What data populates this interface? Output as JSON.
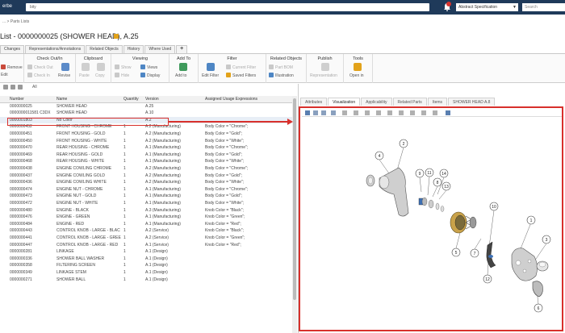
{
  "app": {
    "brand_fragment": "erbe"
  },
  "topbar": {
    "url": "bity",
    "context": "Abstract Specification",
    "search_placeholder": "Search",
    "colors": {
      "bar": "#1f3a5a",
      "alert": "#d8322c"
    }
  },
  "breadcrumb": "... > Parts Lists",
  "page_title": "List - 0000000025 (SHOWER HEAD), A.25",
  "tabs": [
    "Changes",
    "Representations/Annotations",
    "Related Objects",
    "History",
    "Where Used",
    "+"
  ],
  "ribbon": {
    "edit": {
      "remove": "Remove",
      "edit": "Edit"
    },
    "checkout": {
      "title": "Check Out/In",
      "check_out": "Check Out",
      "check_in": "Check In",
      "revise": "Revise"
    },
    "clipboard": {
      "title": "Clipboard",
      "paste": "Paste",
      "copy": "Copy"
    },
    "viewing": {
      "title": "Viewing",
      "show": "Show",
      "hide": "Hide",
      "views": "Views",
      "display": "Display"
    },
    "add_to": {
      "title": "Add To",
      "add_to": "Add to"
    },
    "filter": {
      "title": "Filter",
      "edit_filter": "Edit Filter",
      "current_filter": "Current Filter",
      "saved_filters": "Saved Filters"
    },
    "related": {
      "title": "Related Objects",
      "part_bom": "Part BOM",
      "illustration": "Illustration"
    },
    "publish": {
      "title": "Publish",
      "representation": "Representation"
    },
    "tools": {
      "title": "Tools",
      "open_in": "Open in"
    }
  },
  "filter_row": {
    "label": "All"
  },
  "table": {
    "columns": [
      "Number",
      "Name",
      "Quantity",
      "Version",
      "Assigned Usage Expressions"
    ],
    "rows": [
      [
        "0000000025",
        "SHOWER HEAD",
        "",
        "A.25",
        ""
      ],
      [
        "0000000011581 C3DX",
        "SHOWER HEAD",
        "",
        "A.10",
        ""
      ],
      [
        "0000001803",
        "No Color",
        "",
        "A.2",
        ""
      ],
      [
        "0000000452",
        "FRONT HOUSING - CHROME",
        "1",
        "A.2 (Manufacturing)",
        "Body Color = \"Chrome\";"
      ],
      [
        "0000000451",
        "FRONT HOUSING - GOLD",
        "1",
        "A.2 (Manufacturing)",
        "Body Color = \"Gold\";"
      ],
      [
        "0000000450",
        "FRONT HOUSING - WHITE",
        "1",
        "A.2 (Manufacturing)",
        "Body Color = \"White\";"
      ],
      [
        "0000000470",
        "REAR HOUSING - CHROME",
        "1",
        "A.1 (Manufacturing)",
        "Body Color = \"Chrome\";"
      ],
      [
        "0000000469",
        "REAR HOUSING - GOLD",
        "1",
        "A.1 (Manufacturing)",
        "Body Color = \"Gold\";"
      ],
      [
        "0000000468",
        "REAR HOUSING - WHITE",
        "1",
        "A.1 (Manufacturing)",
        "Body Color = \"White\";"
      ],
      [
        "0000000438",
        "ENGINE COWLING CHROME",
        "1",
        "A.2 (Manufacturing)",
        "Body Color = \"Chrome\";"
      ],
      [
        "0000000437",
        "ENGINE COWLING GOLD",
        "1",
        "A.2 (Manufacturing)",
        "Body Color = \"Gold\";"
      ],
      [
        "0000000436",
        "ENGINE COWLING WHITE",
        "1",
        "A.2 (Manufacturing)",
        "Body Color = \"White\";"
      ],
      [
        "0000000474",
        "ENGINE NUT - CHROME",
        "1",
        "A.1 (Manufacturing)",
        "Body Color = \"Chrome\";"
      ],
      [
        "0000000473",
        "ENGINE NUT - GOLD",
        "1",
        "A.1 (Manufacturing)",
        "Body Color = \"Gold\";"
      ],
      [
        "0000000472",
        "ENGINE NUT - WHITE",
        "1",
        "A.1 (Manufacturing)",
        "Body Color = \"White\";"
      ],
      [
        "0000000480",
        "ENGINE - BLACK",
        "1",
        "A.3 (Manufacturing)",
        "Knob Color = \"Black\";"
      ],
      [
        "0000000476",
        "ENGINE - GREEN",
        "1",
        "A.1 (Manufacturing)",
        "Knob Color = \"Green\";"
      ],
      [
        "0000000484",
        "ENGINE - RED",
        "1",
        "A.1 (Manufacturing)",
        "Knob Color = \"Red\";"
      ],
      [
        "0000000443",
        "CONTROL KNOB - LARGE - BLAC",
        "1",
        "A.2 (Service)",
        "Knob Color = \"Black\";"
      ],
      [
        "0000000441",
        "CONTROL KNOB - LARGE - GREE",
        "1",
        "A.2 (Service)",
        "Knob Color = \"Green\";"
      ],
      [
        "0000000447",
        "CONTROL KNOB - LARGE - RED",
        "1",
        "A.1 (Service)",
        "Knob Color = \"Red\";"
      ],
      [
        "0000000281",
        "LINKAGE",
        "1",
        "A.1 (Design)",
        ""
      ],
      [
        "0000000336",
        "SHOWER BALL WASHER",
        "1",
        "A.1 (Design)",
        ""
      ],
      [
        "0000000358",
        "FILTERING SCREEN",
        "1",
        "A.1 (Design)",
        ""
      ],
      [
        "0000000349",
        "LINKAGE STEM",
        "1",
        "A.1 (Design)",
        ""
      ],
      [
        "0000000271",
        "SHOWER BALL",
        "1",
        "A.1 (Design)",
        ""
      ]
    ],
    "selected_index": 2
  },
  "right_tabs": [
    "Attributes",
    "Visualization",
    "Applicability",
    "Related Parts",
    "Items",
    "SHOWER HEAD A.8"
  ],
  "right_active_tab": 1,
  "viewer": {
    "callouts": [
      "1",
      "2",
      "3",
      "4",
      "5",
      "6",
      "7",
      "8",
      "9",
      "10",
      "11",
      "12",
      "13",
      "14"
    ],
    "highlight_color": "#d8302c"
  }
}
